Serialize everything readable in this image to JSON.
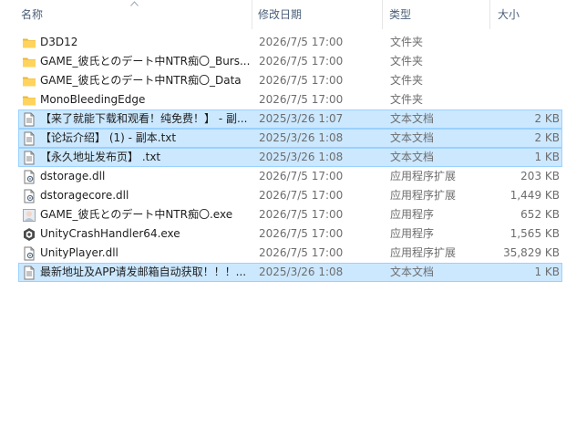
{
  "columns": {
    "name": "名称",
    "date": "修改日期",
    "type": "类型",
    "size": "大小"
  },
  "files": [
    {
      "name": "D3D12",
      "date": "2026/7/5 17:00",
      "type": "文件夹",
      "size": "",
      "icon": "folder-icon",
      "selected": false
    },
    {
      "name": "GAME_彼氏とのデート中NTR痴〇_Burs...",
      "date": "2026/7/5 17:00",
      "type": "文件夹",
      "size": "",
      "icon": "folder-icon",
      "selected": false
    },
    {
      "name": "GAME_彼氏とのデート中NTR痴〇_Data",
      "date": "2026/7/5 17:00",
      "type": "文件夹",
      "size": "",
      "icon": "folder-icon",
      "selected": false
    },
    {
      "name": "MonoBleedingEdge",
      "date": "2026/7/5 17:00",
      "type": "文件夹",
      "size": "",
      "icon": "folder-icon",
      "selected": false
    },
    {
      "name": "【来了就能下载和观看！纯免费！】 - 副...",
      "date": "2025/3/26 1:07",
      "type": "文本文档",
      "size": "2 KB",
      "icon": "text-file-icon",
      "selected": true
    },
    {
      "name": "【论坛介绍】 (1) - 副本.txt",
      "date": "2025/3/26 1:08",
      "type": "文本文档",
      "size": "2 KB",
      "icon": "text-file-icon",
      "selected": true
    },
    {
      "name": "【永久地址发布页】 .txt",
      "date": "2025/3/26 1:08",
      "type": "文本文档",
      "size": "1 KB",
      "icon": "text-file-icon",
      "selected": true
    },
    {
      "name": "dstorage.dll",
      "date": "2026/7/5 17:00",
      "type": "应用程序扩展",
      "size": "203 KB",
      "icon": "dll-file-icon",
      "selected": false
    },
    {
      "name": "dstoragecore.dll",
      "date": "2026/7/5 17:00",
      "type": "应用程序扩展",
      "size": "1,449 KB",
      "icon": "dll-file-icon",
      "selected": false
    },
    {
      "name": "GAME_彼氏とのデート中NTR痴〇.exe",
      "date": "2026/7/5 17:00",
      "type": "应用程序",
      "size": "652 KB",
      "icon": "game-exe-icon",
      "selected": false
    },
    {
      "name": "UnityCrashHandler64.exe",
      "date": "2026/7/5 17:00",
      "type": "应用程序",
      "size": "1,565 KB",
      "icon": "unity-icon",
      "selected": false
    },
    {
      "name": "UnityPlayer.dll",
      "date": "2026/7/5 17:00",
      "type": "应用程序扩展",
      "size": "35,829 KB",
      "icon": "dll-file-icon",
      "selected": false
    },
    {
      "name": "最新地址及APP请发邮箱自动获取！！！...",
      "date": "2025/3/26 1:08",
      "type": "文本文档",
      "size": "1 KB",
      "icon": "text-file-icon",
      "selected": true
    }
  ],
  "colors": {
    "selection_bg": "#cce8ff",
    "selection_border": "#99d1ff",
    "header_text": "#4c607a",
    "folder": "#ffd35c"
  }
}
